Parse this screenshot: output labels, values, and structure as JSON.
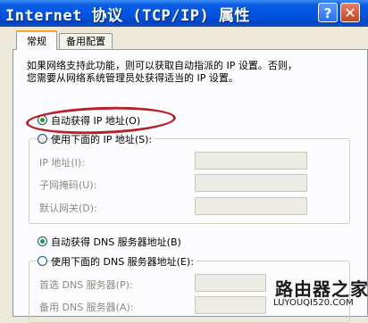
{
  "window": {
    "title": "Internet 协议 (TCP/IP) 属性",
    "help_label": "?",
    "close_label": "✕"
  },
  "tabs": [
    {
      "label": "常规",
      "active": true
    },
    {
      "label": "备用配置",
      "active": false
    }
  ],
  "description": {
    "line1": "如果网络支持此功能，则可以获取自动指派的 IP 设置。否则，",
    "line2": "您需要从网络系统管理员处获得适当的 IP 设置。"
  },
  "ip_section": {
    "auto_option": {
      "label": "自动获得 IP 地址(O)",
      "selected": true
    },
    "manual_option": {
      "label": "使用下面的 IP 地址(S):",
      "selected": false
    },
    "fields": [
      {
        "label": "IP 地址(I):",
        "value": ""
      },
      {
        "label": "子网掩码(U):",
        "value": ""
      },
      {
        "label": "默认网关(D):",
        "value": ""
      }
    ]
  },
  "dns_section": {
    "auto_option": {
      "label": "自动获得 DNS 服务器地址(B)",
      "selected": true
    },
    "manual_option": {
      "label": "使用下面的 DNS 服务器地址(E):",
      "selected": false
    },
    "fields": [
      {
        "label": "首选 DNS 服务器(P):",
        "value": ""
      },
      {
        "label": "备用 DNS 服务器(A):",
        "value": ""
      }
    ]
  },
  "watermark": {
    "main": "路由器之家",
    "sub": "LUYOUQI520.COM"
  },
  "colors": {
    "titlebar": "#0055e5",
    "highlight": "#b8202a",
    "radio_dot": "#21a121"
  }
}
